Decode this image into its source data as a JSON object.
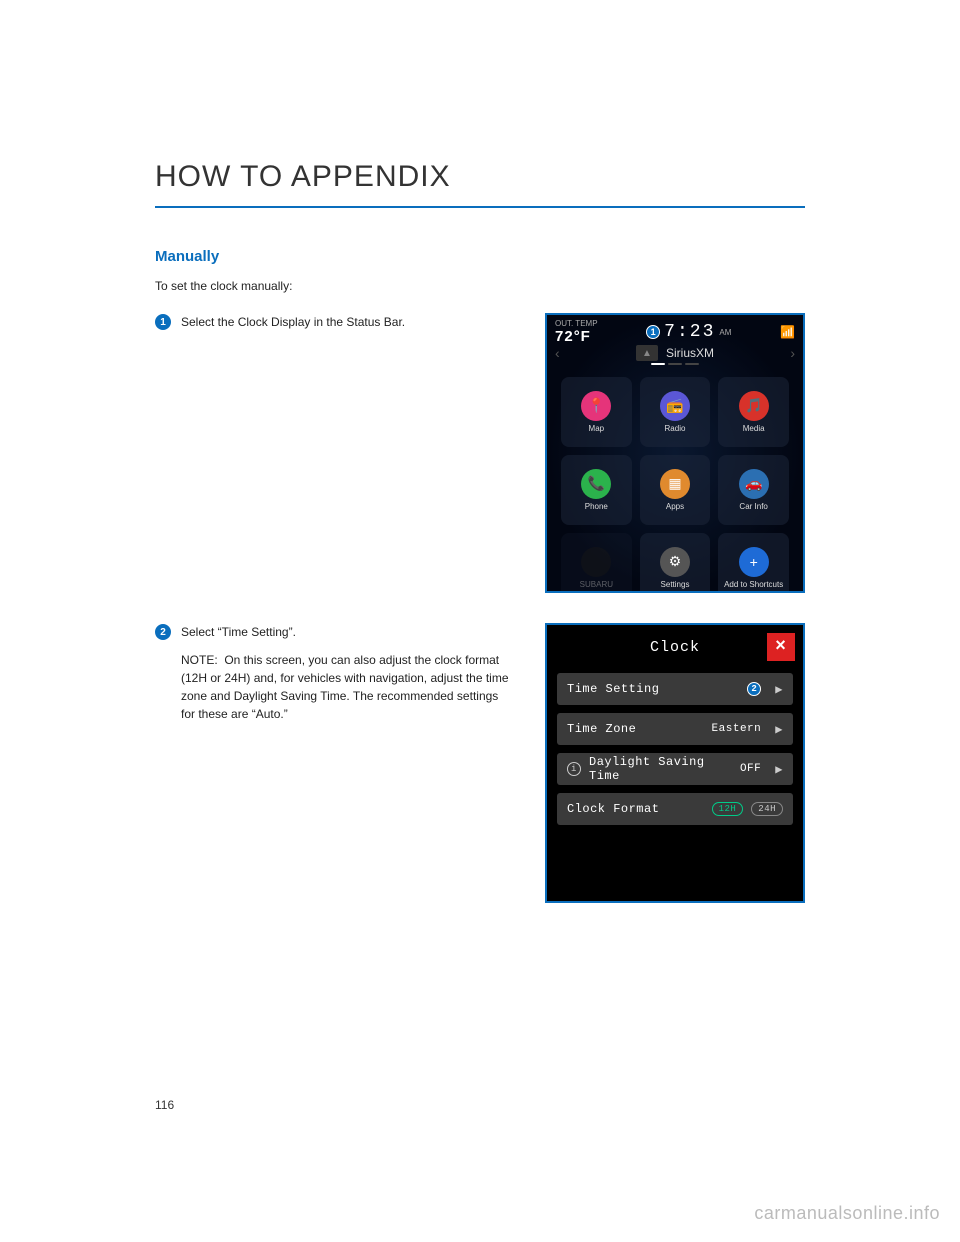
{
  "header": {
    "title": "HOW TO APPENDIX"
  },
  "section": {
    "subheading": "Manually",
    "intro": "To set the clock manually:"
  },
  "steps": [
    {
      "num": "1",
      "text": "Select the Clock Display in the Status Bar."
    },
    {
      "num": "2",
      "text": "Select “Time Setting”.",
      "note_label": "NOTE:",
      "note": "On this screen, you can also adjust the clock format (12H or 24H) and, for vehicles with navigation, adjust the time zone and Daylight Saving Time. The recommended settings for these are “Auto.”"
    }
  ],
  "screenshot1": {
    "out_temp_label": "OUT. TEMP",
    "temp": "72",
    "temp_unit": "°F",
    "callout": "1",
    "time": "7:23",
    "ampm": "AM",
    "source": "SiriusXM",
    "apps": [
      {
        "label": "Map",
        "color": "#e5347a",
        "glyph": "📍"
      },
      {
        "label": "Radio",
        "color": "#5b57d6",
        "glyph": "📻"
      },
      {
        "label": "Media",
        "color": "#d8322a",
        "glyph": "🎵"
      },
      {
        "label": "Phone",
        "color": "#2bb24c",
        "glyph": "📞"
      },
      {
        "label": "Apps",
        "color": "#e08a2e",
        "glyph": "▦"
      },
      {
        "label": "Car Info",
        "color": "#2b6fb2",
        "glyph": "🚗"
      },
      {
        "label": "SUBARU",
        "color": "#222",
        "glyph": "",
        "dim": true
      },
      {
        "label": "Settings",
        "color": "#555",
        "glyph": "⚙"
      },
      {
        "label": "Add to\nShortcuts",
        "color": "#1e6bd6",
        "glyph": "+"
      }
    ]
  },
  "screenshot2": {
    "title": "Clock",
    "callout": "2",
    "rows": {
      "time_setting": {
        "label": "Time Setting"
      },
      "time_zone": {
        "label": "Time Zone",
        "value": "Eastern"
      },
      "dst": {
        "label": "Daylight Saving Time",
        "value": "OFF"
      },
      "format": {
        "label": "Clock Format",
        "opt1": "12H",
        "opt2": "24H"
      }
    }
  },
  "page_number": "116",
  "watermark": "carmanualsonline.info"
}
